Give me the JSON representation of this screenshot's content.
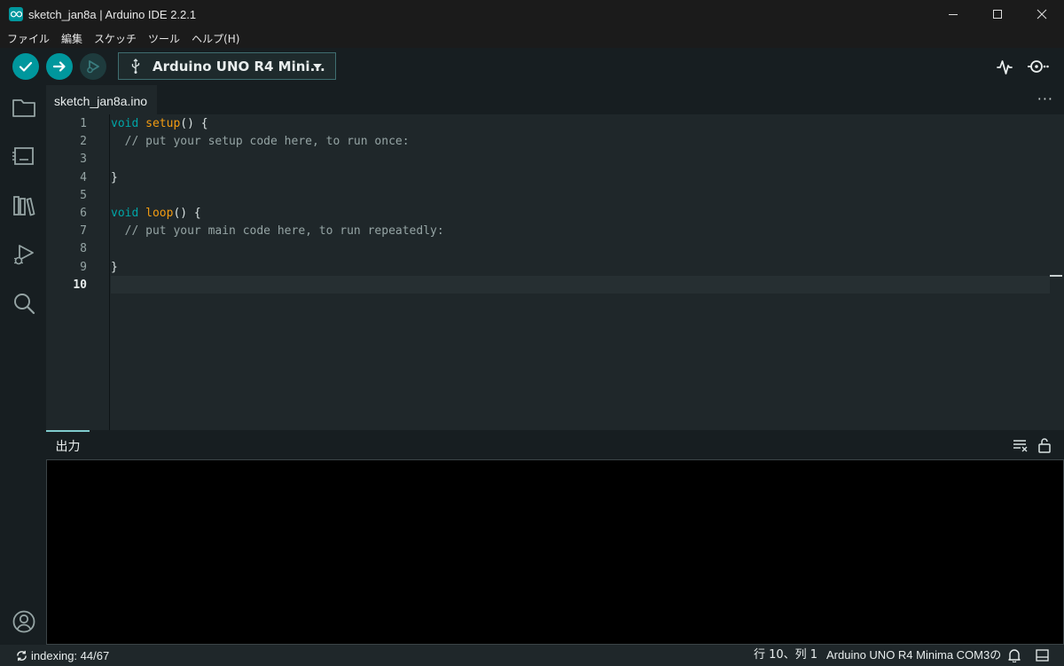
{
  "window": {
    "title": "sketch_jan8a | Arduino IDE 2.2.1",
    "app_icon": "arduino-infinity-icon",
    "controls": [
      "minimize-icon",
      "maximize-icon",
      "close-icon"
    ]
  },
  "menu": {
    "items": [
      "ファイル",
      "編集",
      "スケッチ",
      "ツール",
      "ヘルプ(H)"
    ]
  },
  "toolbar": {
    "verify_icon": "checkmark-icon",
    "upload_icon": "arrow-right-icon",
    "debug_icon": "debug-icon",
    "board_label": "Arduino UNO R4 Mini...",
    "board_icon": "usb-icon",
    "plotter_icon": "serial-plotter-icon",
    "monitor_icon": "serial-monitor-icon"
  },
  "sidebar": {
    "items": [
      "folder-icon",
      "board-manager-icon",
      "library-icon",
      "debug-run-icon",
      "search-icon"
    ],
    "bottom": "account-icon"
  },
  "tabs": {
    "active": "sketch_jan8a.ino",
    "more": "···"
  },
  "editor": {
    "line_numbers": [
      "1",
      "2",
      "3",
      "4",
      "5",
      "6",
      "7",
      "8",
      "9",
      "10"
    ],
    "current_line": "10",
    "lines": [
      [
        {
          "t": "kw",
          "s": "void"
        },
        {
          "t": "pl",
          "s": " "
        },
        {
          "t": "fn",
          "s": "setup"
        },
        {
          "t": "pl",
          "s": "() {"
        }
      ],
      [
        {
          "t": "cm",
          "s": "  // put your setup code here, to run once:"
        }
      ],
      [],
      [
        {
          "t": "pl",
          "s": "}"
        }
      ],
      [],
      [
        {
          "t": "kw",
          "s": "void"
        },
        {
          "t": "pl",
          "s": " "
        },
        {
          "t": "fn",
          "s": "loop"
        },
        {
          "t": "pl",
          "s": "() {"
        }
      ],
      [
        {
          "t": "cm",
          "s": "  // put your main code here, to run repeatedly:"
        }
      ],
      [],
      [
        {
          "t": "pl",
          "s": "}"
        }
      ],
      []
    ]
  },
  "output": {
    "tab_label": "出力",
    "clear_icon": "clear-output-icon",
    "lock_icon": "unlock-icon"
  },
  "status": {
    "indexing": "indexing: 44/67",
    "position": "行 10、列 1",
    "board": "Arduino UNO R4 Minima COM3の",
    "bell_icon": "bell-icon",
    "layout_icon": "panel-toggle-icon"
  },
  "colors": {
    "accent": "#00979d",
    "keyword": "#00a5a7",
    "function": "#f39c12",
    "comment": "#95a4a4",
    "editor_bg": "#1f272a"
  }
}
